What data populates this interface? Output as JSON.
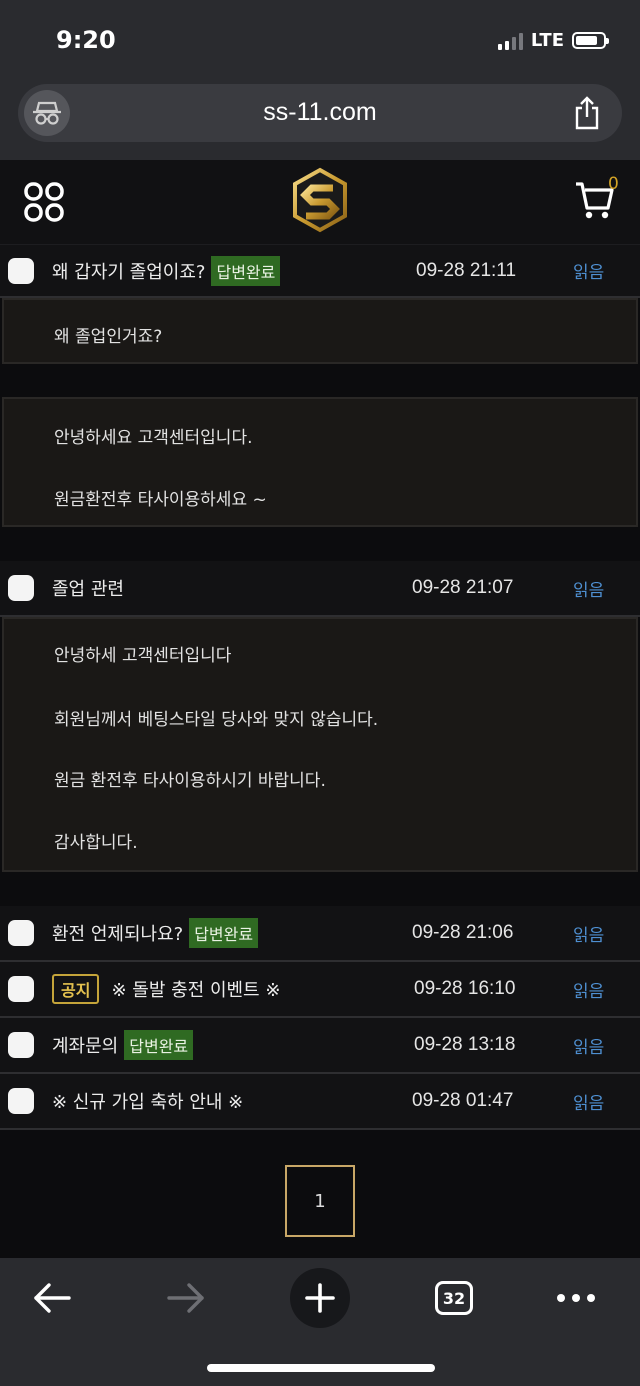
{
  "status_bar": {
    "time": "9:20",
    "network": "LTE"
  },
  "browser": {
    "url": "ss-11.com",
    "tab_count": "32"
  },
  "header": {
    "cart_count": "0"
  },
  "rows": [
    {
      "title": "왜 갑자기 졸업이죠?",
      "badge": "답변완료",
      "date": "09-28 21:11",
      "read": "읽음"
    },
    {
      "title": "졸업 관련",
      "date": "09-28 21:07",
      "read": "읽음"
    },
    {
      "title": "환전 언제되나요?",
      "badge": "답변완료",
      "date": "09-28 21:06",
      "read": "읽음"
    },
    {
      "notice": "공지",
      "title": "※ 돌발 충전 이벤트 ※",
      "date": "09-28 16:10",
      "read": "읽음"
    },
    {
      "title": "계좌문의",
      "badge": "답변완료",
      "date": "09-28 13:18",
      "read": "읽음"
    },
    {
      "title": "※ 신규 가입 축하 안내 ※",
      "date": "09-28 01:47",
      "read": "읽음"
    }
  ],
  "messages": {
    "q1_question": "왜 졸업인거죠?",
    "q1_answer": [
      "안녕하세요 고객센터입니다.",
      "원금환전후 타사이용하세요 ~"
    ],
    "q2_answer": [
      "안녕하세 고객센터입니다",
      "회원님께서 베팅스타일 당사와 맞지 않습니다.",
      "원금 환전후 타사이용하시기 바랍니다.",
      "감사합니다."
    ]
  },
  "pagination": {
    "current": "1"
  },
  "colors": {
    "accent_gold": "#c9a867",
    "badge_green": "#2f6a22",
    "read_blue": "#4e8fd1"
  }
}
